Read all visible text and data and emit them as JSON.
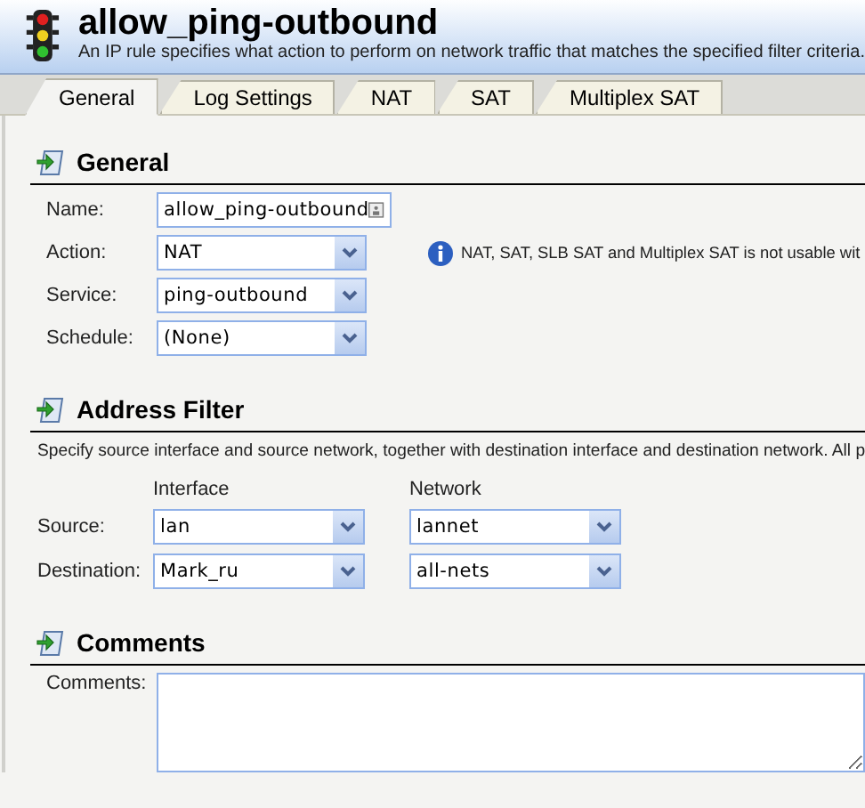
{
  "header": {
    "title": "allow_ping-outbound",
    "subtitle": "An IP rule specifies what action to perform on network traffic that matches the specified filter criteria."
  },
  "tabs": [
    {
      "label": "General",
      "selected": true
    },
    {
      "label": "Log Settings",
      "selected": false
    },
    {
      "label": "NAT",
      "selected": false
    },
    {
      "label": "SAT",
      "selected": false
    },
    {
      "label": "Multiplex SAT",
      "selected": false
    }
  ],
  "general": {
    "heading": "General",
    "fields": [
      {
        "label": "Name:",
        "value": "allow_ping-outbound",
        "kind": "text"
      },
      {
        "label": "Action:",
        "value": "NAT",
        "kind": "select"
      },
      {
        "label": "Service:",
        "value": "ping-outbound",
        "kind": "select"
      },
      {
        "label": "Schedule:",
        "value": "(None)",
        "kind": "select"
      }
    ],
    "info": "NAT, SAT, SLB SAT and Multiplex SAT is not usable wit"
  },
  "address_filter": {
    "heading": "Address Filter",
    "description": "Specify source interface and source network, together with destination interface and destination network. All p",
    "columns": [
      "Interface",
      "Network"
    ],
    "rows": [
      {
        "label": "Source:",
        "interface": "lan",
        "network": "lannet"
      },
      {
        "label": "Destination:",
        "interface": "Mark_ru",
        "network": "all-nets"
      }
    ]
  },
  "comments": {
    "heading": "Comments",
    "label": "Comments:"
  }
}
